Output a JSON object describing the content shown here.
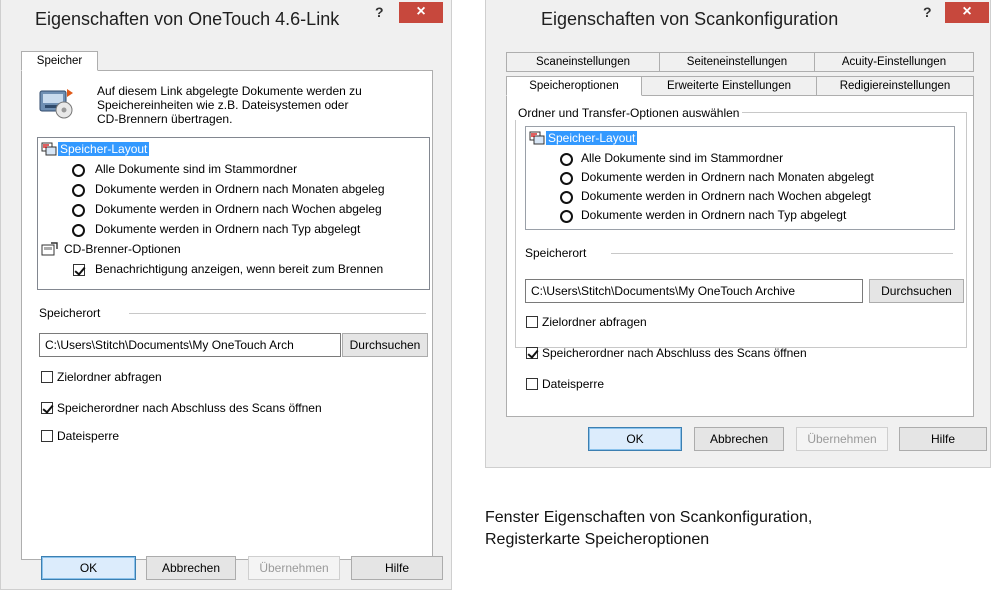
{
  "dialog1": {
    "title": "Eigenschaften von OneTouch 4.6-Link",
    "help": "?",
    "close": "×",
    "tab": "Speicher",
    "description": [
      "Auf diesem Link abgelegte Dokumente werden zu",
      "Speichereinheiten wie z.B. Dateisystemen oder",
      "CD-Brennern übertragen."
    ],
    "tree": {
      "layout_label": "Speicher-Layout",
      "options": [
        "Alle Dokumente sind im Stammordner",
        "Dokumente werden in Ordnern nach Monaten abgeleg",
        "Dokumente werden in Ordnern nach Wochen abgeleg",
        "Dokumente werden in Ordnern nach Typ abgelegt"
      ],
      "cd_label": "CD-Brenner-Optionen",
      "cd_option": "Benachrichtigung anzeigen, wenn bereit zum Brennen"
    },
    "location_label": "Speicherort",
    "path_value": "C:\\Users\\Stitch\\Documents\\My OneTouch Arch",
    "browse": "Durchsuchen",
    "checks": [
      {
        "label": "Zielordner abfragen",
        "checked": false
      },
      {
        "label": "Speicherordner nach Abschluss des Scans öffnen",
        "checked": true
      },
      {
        "label": "Dateisperre",
        "checked": false
      }
    ],
    "buttons": {
      "ok": "OK",
      "cancel": "Abbrechen",
      "apply": "Übernehmen",
      "help": "Hilfe"
    }
  },
  "dialog2": {
    "title": "Eigenschaften von Scankonfiguration",
    "help": "?",
    "close": "×",
    "tabs_row1": [
      "Scaneinstellungen",
      "Seiteneinstellungen",
      "Acuity-Einstellungen"
    ],
    "tabs_row2": [
      "Speicheroptionen",
      "Erweiterte Einstellungen",
      "Redigiereinstellungen"
    ],
    "group_label": "Ordner und Transfer-Optionen auswählen",
    "tree": {
      "layout_label": "Speicher-Layout",
      "options": [
        "Alle Dokumente sind im Stammordner",
        "Dokumente werden in Ordnern nach Monaten abgelegt",
        "Dokumente werden in Ordnern nach Wochen abgelegt",
        "Dokumente werden in Ordnern nach Typ abgelegt"
      ]
    },
    "location_label": "Speicherort",
    "path_value": "C:\\Users\\Stitch\\Documents\\My OneTouch Archive",
    "browse": "Durchsuchen",
    "checks": [
      {
        "label": "Zielordner abfragen",
        "checked": false
      },
      {
        "label": "Speicherordner nach Abschluss des Scans öffnen",
        "checked": true
      },
      {
        "label": "Dateisperre",
        "checked": false
      }
    ],
    "buttons": {
      "ok": "OK",
      "cancel": "Abbrechen",
      "apply": "Übernehmen",
      "help": "Hilfe"
    }
  },
  "caption": {
    "line1": "Fenster Eigenschaften von Scankonfiguration,",
    "line2": "Registerkarte Speicheroptionen"
  },
  "colors": {
    "close_button": "#c7483d",
    "selection": "#3399ff",
    "default_button": "#dcecfc"
  }
}
